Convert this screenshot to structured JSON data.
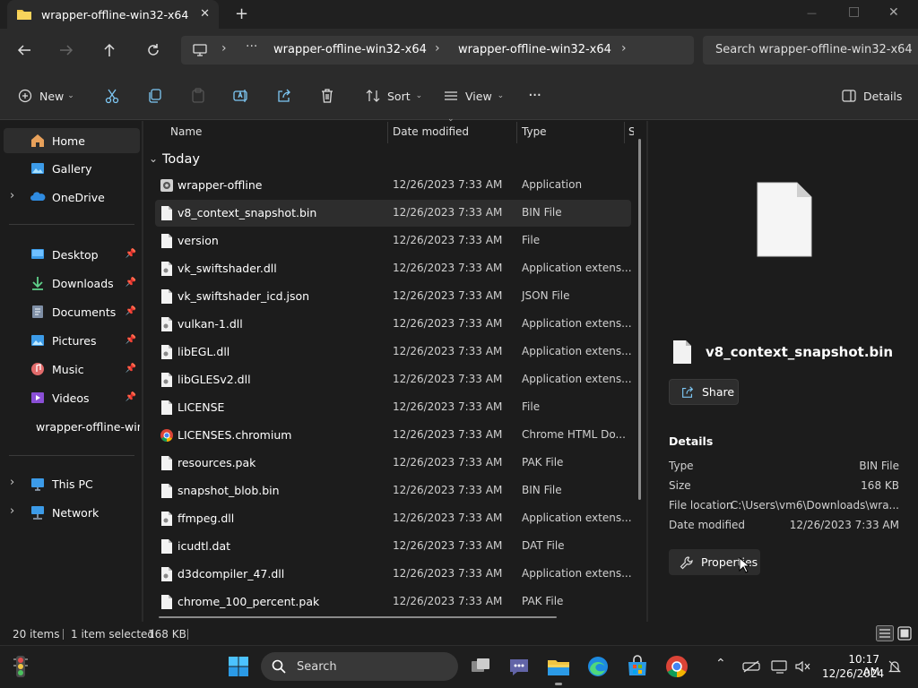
{
  "window": {
    "tab_title": "wrapper-offline-win32-x64",
    "new_tab": "+",
    "tab_close": "✕",
    "controls": {
      "minimize": "—",
      "maximize": "□",
      "close": "✕"
    }
  },
  "address": {
    "crumbs": [
      "wrapper-offline-win32-x64",
      "wrapper-offline-win32-x64"
    ],
    "search_placeholder": "Search wrapper-offline-win32-x64"
  },
  "toolbar": {
    "new_label": "New",
    "sort_label": "Sort",
    "view_label": "View",
    "more_label": "···",
    "details_label": "Details"
  },
  "sidebar": {
    "items": [
      {
        "label": "Home",
        "icon": "home-icon"
      },
      {
        "label": "Gallery",
        "icon": "gallery-icon"
      },
      {
        "label": "OneDrive",
        "icon": "onedrive-icon"
      },
      {
        "label": "Desktop",
        "icon": "desktop-icon"
      },
      {
        "label": "Downloads",
        "icon": "downloads-icon"
      },
      {
        "label": "Documents",
        "icon": "documents-icon"
      },
      {
        "label": "Pictures",
        "icon": "pictures-icon"
      },
      {
        "label": "Music",
        "icon": "music-icon"
      },
      {
        "label": "Videos",
        "icon": "videos-icon"
      },
      {
        "label": "wrapper-offline-win",
        "icon": "folder-icon"
      },
      {
        "label": "This PC",
        "icon": "pc-icon"
      },
      {
        "label": "Network",
        "icon": "network-icon"
      }
    ]
  },
  "columns": {
    "name": "Name",
    "date": "Date modified",
    "type": "Type",
    "size": "S"
  },
  "group_label": "Today",
  "files": [
    {
      "name": "wrapper-offline",
      "date": "12/26/2023 7:33 AM",
      "type": "Application"
    },
    {
      "name": "v8_context_snapshot.bin",
      "date": "12/26/2023 7:33 AM",
      "type": "BIN File"
    },
    {
      "name": "version",
      "date": "12/26/2023 7:33 AM",
      "type": "File"
    },
    {
      "name": "vk_swiftshader.dll",
      "date": "12/26/2023 7:33 AM",
      "type": "Application extens..."
    },
    {
      "name": "vk_swiftshader_icd.json",
      "date": "12/26/2023 7:33 AM",
      "type": "JSON File"
    },
    {
      "name": "vulkan-1.dll",
      "date": "12/26/2023 7:33 AM",
      "type": "Application extens..."
    },
    {
      "name": "libEGL.dll",
      "date": "12/26/2023 7:33 AM",
      "type": "Application extens..."
    },
    {
      "name": "libGLESv2.dll",
      "date": "12/26/2023 7:33 AM",
      "type": "Application extens..."
    },
    {
      "name": "LICENSE",
      "date": "12/26/2023 7:33 AM",
      "type": "File"
    },
    {
      "name": "LICENSES.chromium",
      "date": "12/26/2023 7:33 AM",
      "type": "Chrome HTML Do..."
    },
    {
      "name": "resources.pak",
      "date": "12/26/2023 7:33 AM",
      "type": "PAK File"
    },
    {
      "name": "snapshot_blob.bin",
      "date": "12/26/2023 7:33 AM",
      "type": "BIN File"
    },
    {
      "name": "ffmpeg.dll",
      "date": "12/26/2023 7:33 AM",
      "type": "Application extens..."
    },
    {
      "name": "icudtl.dat",
      "date": "12/26/2023 7:33 AM",
      "type": "DAT File"
    },
    {
      "name": "d3dcompiler_47.dll",
      "date": "12/26/2023 7:33 AM",
      "type": "Application extens..."
    },
    {
      "name": "chrome_100_percent.pak",
      "date": "12/26/2023 7:33 AM",
      "type": "PAK File"
    }
  ],
  "details": {
    "filename": "v8_context_snapshot.bin",
    "share_label": "Share",
    "section_title": "Details",
    "rows": [
      {
        "label": "Type",
        "value": "BIN File"
      },
      {
        "label": "Size",
        "value": "168 KB"
      },
      {
        "label": "File location",
        "value": "C:\\Users\\vm6\\Downloads\\wra..."
      },
      {
        "label": "Date modified",
        "value": "12/26/2023 7:33 AM"
      }
    ],
    "properties_label": "Properties"
  },
  "status": {
    "items": "20 items",
    "selected": "1 item selected",
    "size": "168 KB"
  },
  "taskbar": {
    "search_label": "Search",
    "time": "10:17 AM",
    "date": "12/26/2024"
  },
  "colors": {
    "accent": "#60cdff",
    "folder": "#f0c542",
    "selected_row": "#2d2d2d",
    "window_bg": "#1c1c1c"
  }
}
